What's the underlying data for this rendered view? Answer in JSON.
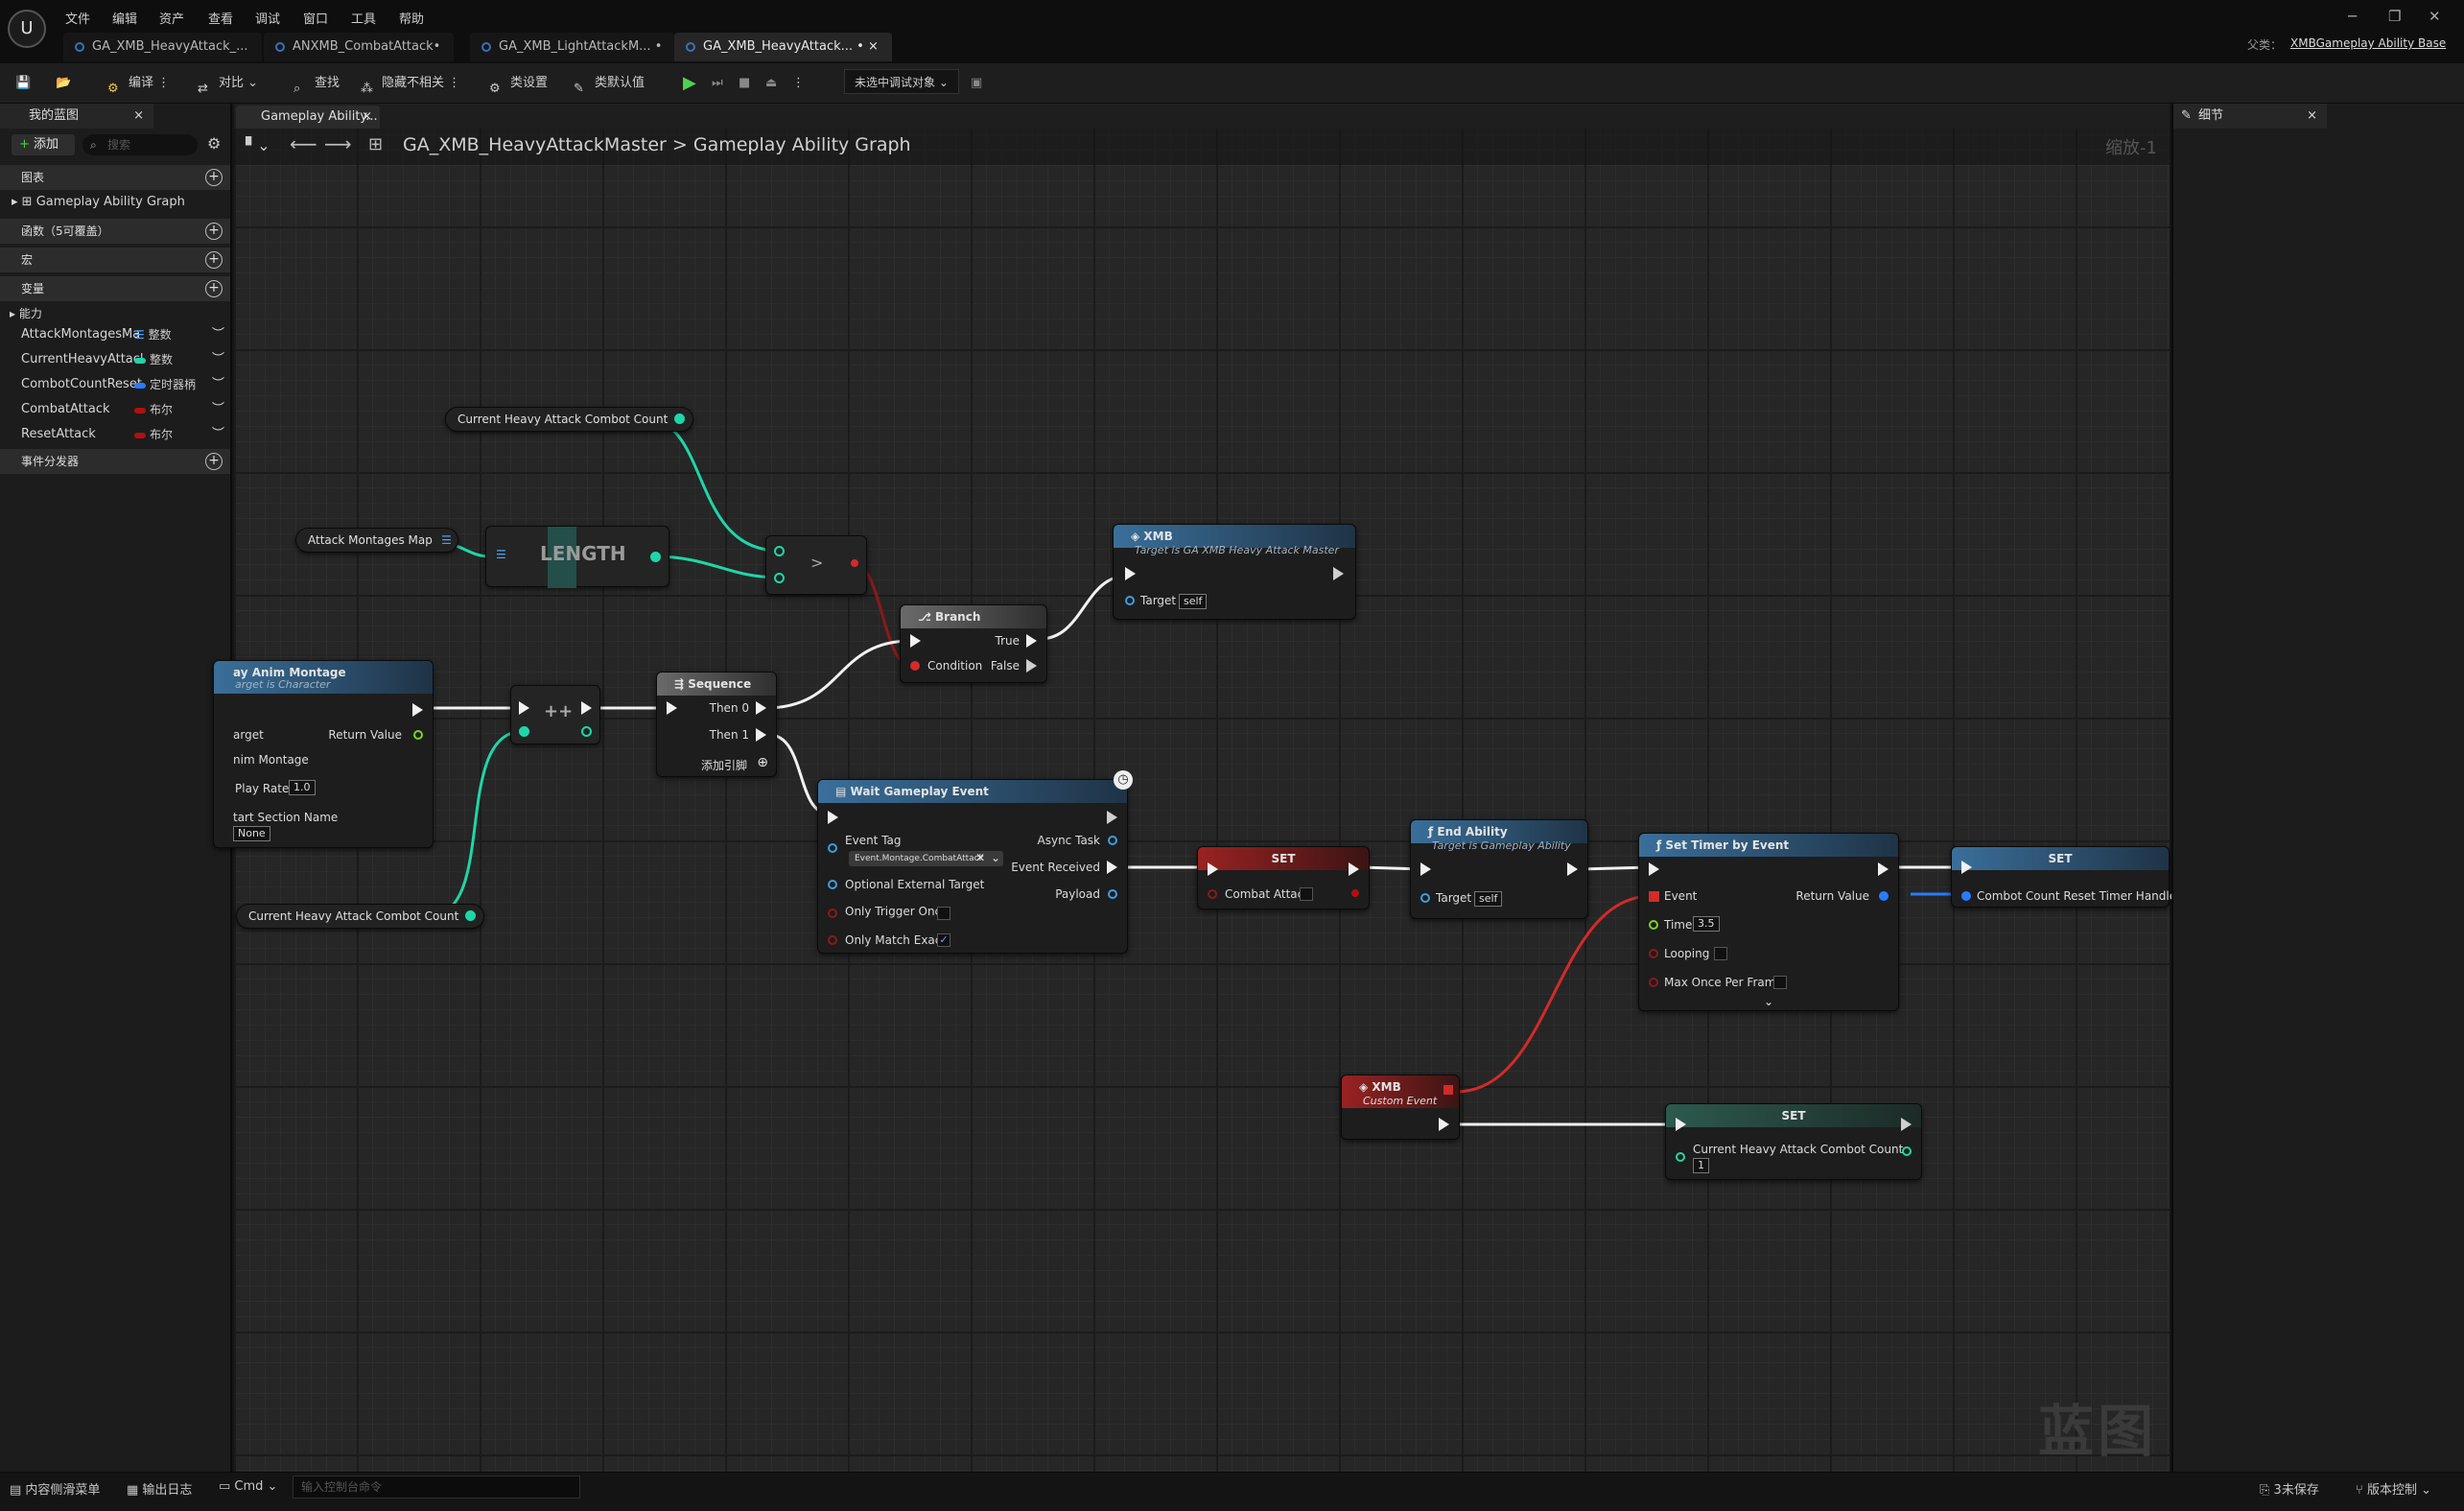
{
  "menu": [
    "文件",
    "编辑",
    "资产",
    "查看",
    "调试",
    "窗口",
    "工具",
    "帮助"
  ],
  "tabs": [
    "GA_XMB_HeavyAttack_...",
    "ANXMB_CombatAttack•",
    "GA_XMB_LightAttackM... •",
    "GA_XMB_HeavyAttack... • ×"
  ],
  "parent": {
    "label": "父类：",
    "value": "XMBGameplay Ability Base"
  },
  "toolbar": {
    "compile": "编译",
    "diff": "对比",
    "find": "查找",
    "hide_unrelated": "隐藏不相关",
    "class_settings": "类设置",
    "class_defaults": "类默认值",
    "debug_object": "未选中调试对象"
  },
  "left_panel": {
    "tab": "我的蓝图",
    "add_button": "添加",
    "search_placeholder": "搜索",
    "sec_graphs": "图表",
    "graph_item": "Gameplay Ability Graph",
    "sec_functions": "函数（5可覆盖）",
    "sec_macros": "宏",
    "sec_variables": "变量",
    "category": "能力",
    "variables": [
      {
        "name": "AttackMontagesMa",
        "type": "整数",
        "color": "#4aa3ff"
      },
      {
        "name": "CurrentHeavyAttacl",
        "type": "整数",
        "color": "#1fd6a8"
      },
      {
        "name": "CombotCountReset",
        "type": "定时器柄",
        "color": "#2a7bff"
      },
      {
        "name": "CombatAttack",
        "type": "布尔",
        "color": "#b01010"
      },
      {
        "name": "ResetAttack",
        "type": "布尔",
        "color": "#b01010"
      }
    ],
    "sec_dispatchers": "事件分发器"
  },
  "graph": {
    "tab": "Gameplay Ability...",
    "breadcrumb_asset": "GA_XMB_HeavyAttackMaster",
    "breadcrumb_sep": ">",
    "breadcrumb_graph": "Gameplay Ability Graph",
    "zoom": "缩放-1",
    "watermark": "蓝图"
  },
  "nodes": {
    "get_combo_top": "Current Heavy Attack Combot Count",
    "attack_montages_map": "Attack Montages Map",
    "length": "LENGTH",
    "greater": ">",
    "xmb_call": {
      "title": "XMB",
      "subtitle": "Target is GA XMB Heavy Attack Master",
      "target": "Target",
      "self": "self"
    },
    "branch": {
      "title": "Branch",
      "true": "True",
      "false": "False",
      "condition": "Condition"
    },
    "play_montage": {
      "title": "ay Anim Montage",
      "subtitle": "arget is Character",
      "target": "arget",
      "return": "Return Value",
      "anim": "nim Montage",
      "rate": "Play Rate",
      "rate_val": "1.0",
      "section": "tart Section Name",
      "section_val": "None"
    },
    "increment": "++",
    "sequence": {
      "title": "Sequence",
      "then0": "Then 0",
      "then1": "Then 1",
      "add_pin": "添加引脚"
    },
    "wait_event": {
      "title": "Wait Gameplay Event",
      "event_tag": "Event Tag",
      "tag_value": "Event.Montage.CombatAttack",
      "async": "Async Task",
      "received": "Event Received",
      "payload": "Payload",
      "opt_target": "Optional External Target",
      "trigger_once": "Only Trigger Once",
      "match_exact": "Only Match Exact"
    },
    "get_combo_bottom": "Current Heavy Attack Combot Count",
    "set_combat": {
      "title": "SET",
      "var": "Combat Attack"
    },
    "end_ability": {
      "title": "End Ability",
      "subtitle": "Target is Gameplay Ability",
      "target": "Target",
      "self": "self"
    },
    "set_timer": {
      "title": "Set Timer by Event",
      "event": "Event",
      "return": "Return Value",
      "time": "Time",
      "time_val": "3.5",
      "looping": "Looping",
      "max_once": "Max Once Per Frame"
    },
    "set_handle": {
      "title": "SET",
      "var": "Combot Count Reset Timer Handle"
    },
    "custom_event": {
      "title": "XMB",
      "subtitle": "Custom Event"
    },
    "set_combo": {
      "title": "SET",
      "var": "Current Heavy Attack Combot Count",
      "val": "1"
    }
  },
  "right_panel": {
    "tab": "细节"
  },
  "statusbar": {
    "content_drawer": "内容侧滑菜单",
    "output_log": "输出日志",
    "cmd": "Cmd",
    "cmd_placeholder": "输入控制台命令",
    "unsaved": "3未保存",
    "version_control": "版本控制"
  }
}
